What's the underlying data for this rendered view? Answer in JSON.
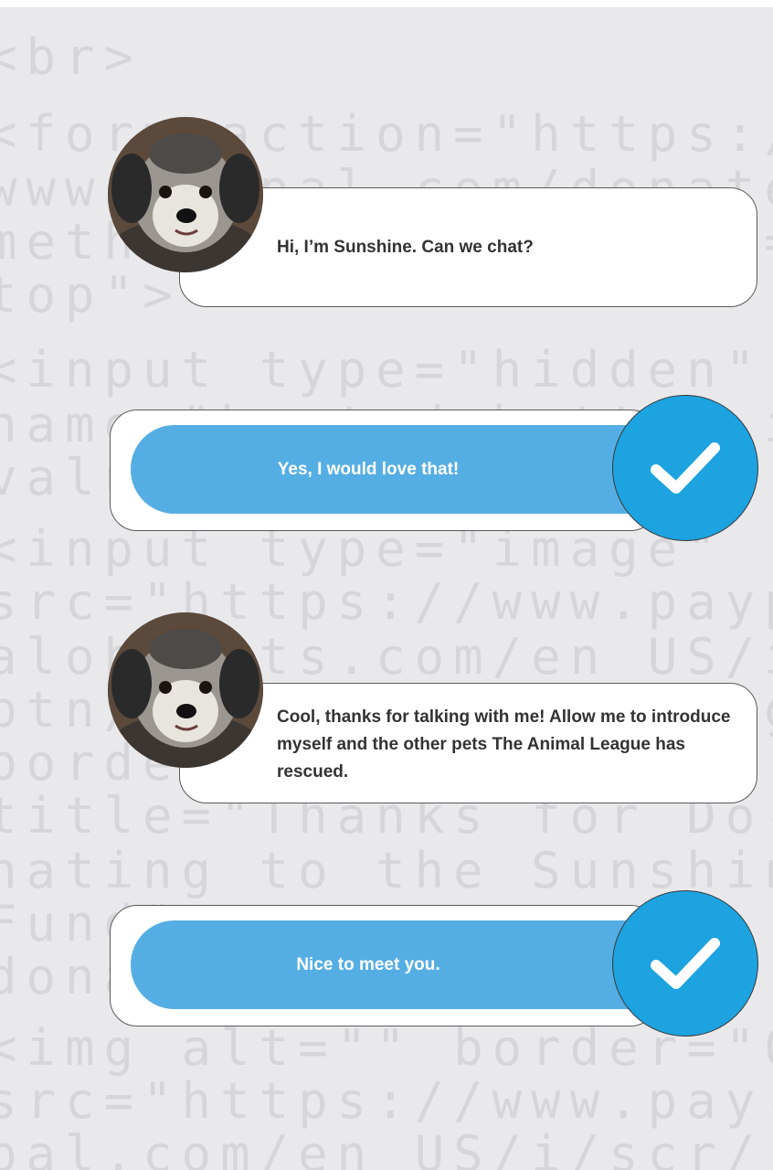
{
  "background": {
    "color": "#e9e9ec",
    "code_lines": [
      "<br>",
      "<form action=\"https://",
      "www.paypal.com/donate\"",
      "method=\"post\" target=\"_",
      "top\">",
      "<input type=\"hidden\"",
      "name=\"hosted_button_id\"",
      "value=\"",
      "<input type=\"image\"",
      "src=\"https://www.payp-",
      "alobjects.com/en_US/i/",
      "btn/btn_donateCC_LG.gif\"",
      "border=\"0\"",
      "title=\"Thanks for Do-",
      "nating to the Sunshine",
      "Fund\"",
      "donate\">",
      "<img alt=\"\" border=\"0\"",
      "src=\"https://www.pay-",
      "pal.com/en_US/i/scr/"
    ]
  },
  "messages": [
    {
      "sender": "Sunshine",
      "text": "Hi, I’m Sunshine. Can we chat?"
    },
    {
      "sender": "Sunshine",
      "text": "Cool, thanks for talking with me! Allow me to introduce myself and the other pets The Animal League has rescued."
    }
  ],
  "replies": [
    {
      "label": "Yes, I would love that!",
      "icon": "checkmark-icon"
    },
    {
      "label": "Nice to meet you.",
      "icon": "checkmark-icon"
    }
  ],
  "colors": {
    "reply_pill": "#55aee3",
    "check_circle": "#1ca3e0",
    "bubble_border": "#5a5a5a",
    "text": "#333333"
  }
}
